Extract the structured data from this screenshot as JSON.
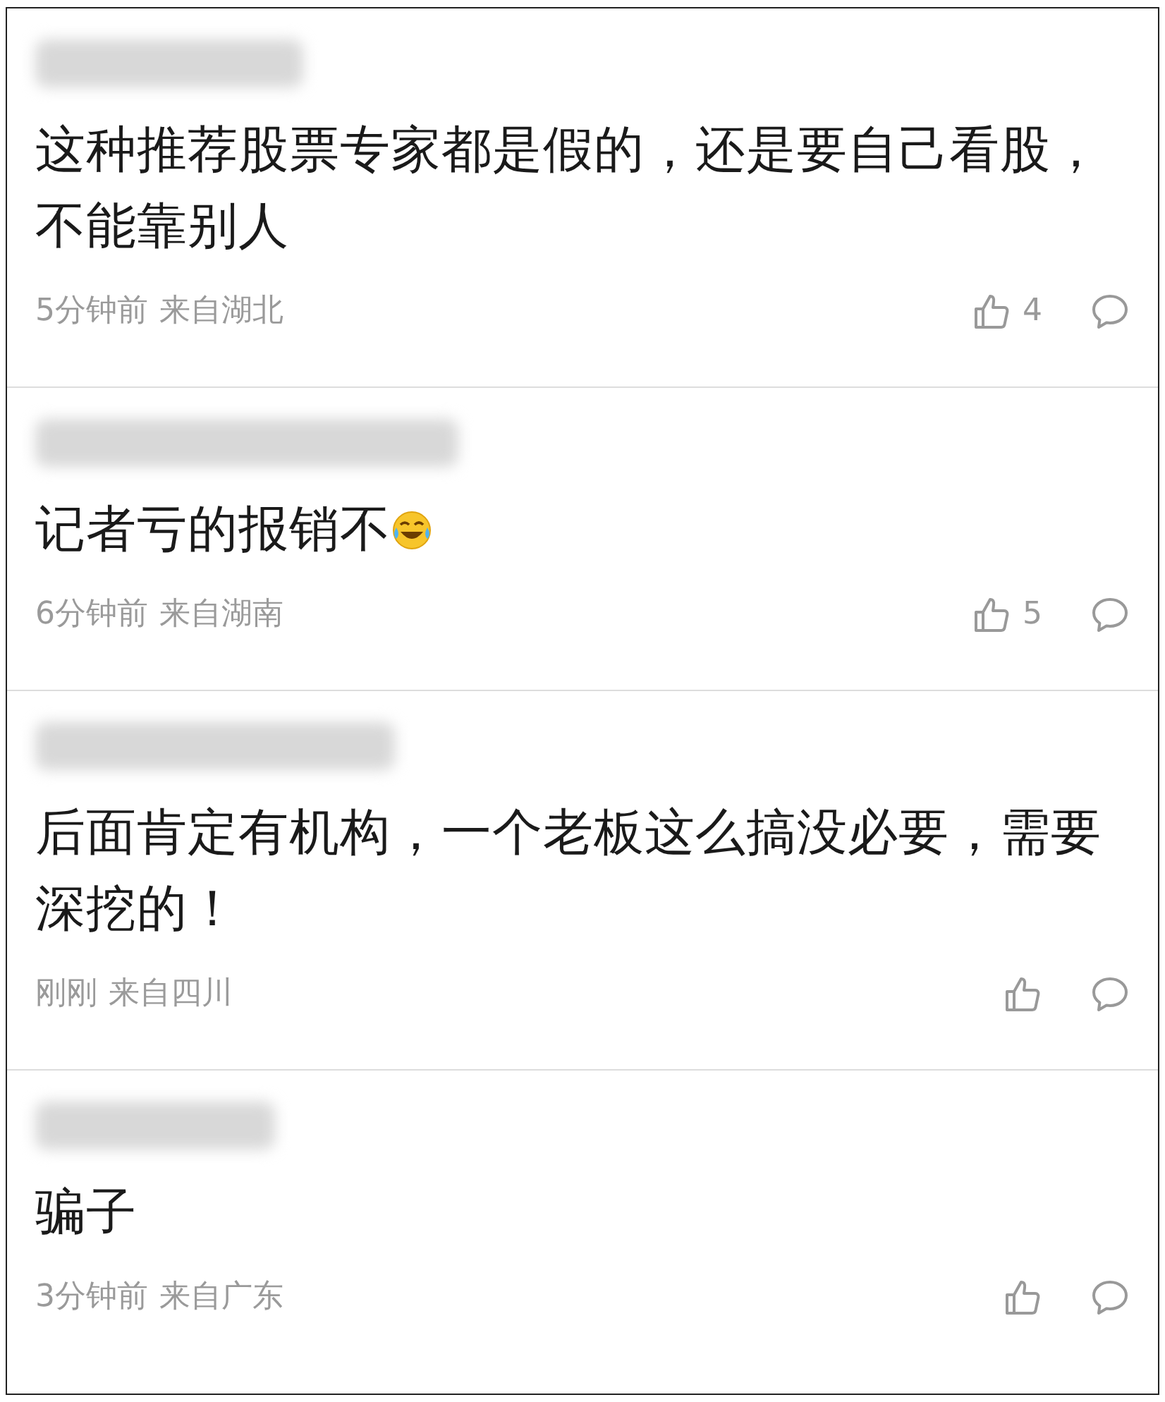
{
  "comments": [
    {
      "text": "这种推荐股票专家都是假的，还是要自己看股，不能靠别人",
      "trailing_emoji": false,
      "time": "5分钟前",
      "location": "来自湖北",
      "likes": "4"
    },
    {
      "text": "记者亏的报销不",
      "trailing_emoji": true,
      "time": "6分钟前",
      "location": "来自湖南",
      "likes": "5"
    },
    {
      "text": "后面肯定有机构，一个老板这么搞没必要，需要深挖的！",
      "trailing_emoji": false,
      "time": "刚刚",
      "location": "来自四川"
    },
    {
      "text": "骗子",
      "trailing_emoji": false,
      "time": "3分钟前",
      "location": "来自广东"
    }
  ]
}
